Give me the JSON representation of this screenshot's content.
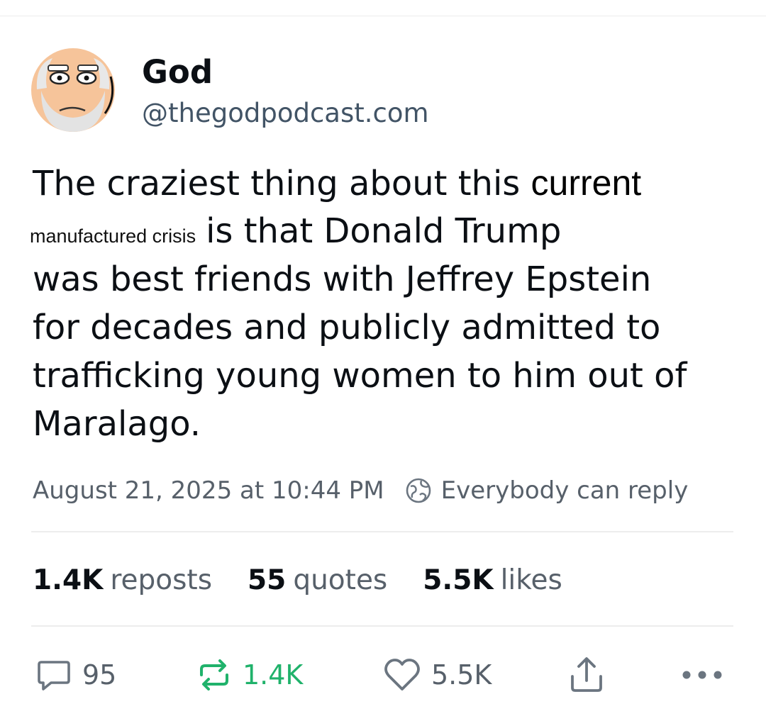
{
  "author": {
    "name": "God",
    "handle": "@thegodpodcast.com"
  },
  "post": {
    "line1_a": "The craziest thing about this ",
    "line1_b": "current",
    "line2_small": "manufactured crisis",
    "line2_rest": "is that Donald Trump",
    "line3": "was best friends with Jeffrey Epstein",
    "line4": "for decades and publicly admitted to",
    "line5": "trafficking young women to him out of",
    "line6": "Maralago."
  },
  "meta": {
    "timestamp": "August 21, 2025 at 10:44 PM",
    "reply_setting": "Everybody can reply"
  },
  "stats": {
    "reposts_count": "1.4K",
    "reposts_label": "reposts",
    "quotes_count": "55",
    "quotes_label": "quotes",
    "likes_count": "5.5K",
    "likes_label": "likes"
  },
  "actions": {
    "reply_count": "95",
    "repost_count": "1.4K",
    "like_count": "5.5K"
  },
  "icons": {
    "reply": "reply-bubble-icon",
    "repost": "repost-arrows-icon",
    "like": "heart-icon",
    "share": "share-icon",
    "more": "more-dots-icon",
    "globe": "globe-icon"
  },
  "colors": {
    "repost_accent": "#20b26b",
    "muted_text": "#57606a"
  }
}
